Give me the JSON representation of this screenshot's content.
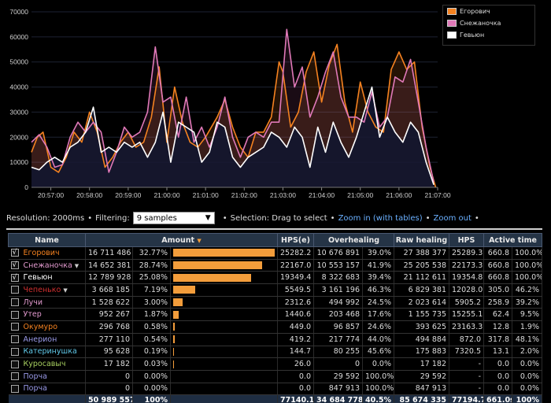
{
  "chart_data": {
    "type": "line",
    "y_ticks": [
      "0",
      "10000",
      "20000",
      "30000",
      "40000",
      "50000",
      "60000",
      "70000"
    ],
    "ylim": [
      0,
      70000
    ],
    "x_ticks": [
      "20:57:00",
      "20:58:00",
      "20:59:00",
      "21:00:00",
      "21:01:00",
      "21:02:00",
      "21:03:00",
      "21:04:00",
      "21:05:00",
      "21:06:00",
      "21:07:00"
    ],
    "xlim": [
      0,
      10.5
    ],
    "grid": true,
    "legend_position": "top-right",
    "series": [
      {
        "name": "Егорович",
        "color": "#f58220",
        "fill": "#f58220",
        "values": [
          [
            0,
            14000
          ],
          [
            0.15,
            20000
          ],
          [
            0.3,
            22000
          ],
          [
            0.5,
            8000
          ],
          [
            0.7,
            6000
          ],
          [
            0.9,
            12000
          ],
          [
            1.1,
            22000
          ],
          [
            1.3,
            18000
          ],
          [
            1.5,
            30000
          ],
          [
            1.7,
            22000
          ],
          [
            1.9,
            8000
          ],
          [
            2.1,
            12000
          ],
          [
            2.3,
            18000
          ],
          [
            2.5,
            22000
          ],
          [
            2.7,
            16000
          ],
          [
            2.9,
            18000
          ],
          [
            3.1,
            28000
          ],
          [
            3.3,
            48000
          ],
          [
            3.5,
            18000
          ],
          [
            3.7,
            40000
          ],
          [
            3.9,
            26000
          ],
          [
            4.1,
            18000
          ],
          [
            4.3,
            16000
          ],
          [
            4.5,
            20000
          ],
          [
            4.8,
            28000
          ],
          [
            5.0,
            35000
          ],
          [
            5.2,
            24000
          ],
          [
            5.4,
            16000
          ],
          [
            5.6,
            12000
          ],
          [
            5.8,
            22000
          ],
          [
            6.0,
            22000
          ],
          [
            6.2,
            28000
          ],
          [
            6.4,
            50000
          ],
          [
            6.5,
            46000
          ],
          [
            6.7,
            24000
          ],
          [
            6.9,
            30000
          ],
          [
            7.1,
            46000
          ],
          [
            7.3,
            54000
          ],
          [
            7.5,
            34000
          ],
          [
            7.7,
            49000
          ],
          [
            7.9,
            57000
          ],
          [
            8.1,
            34000
          ],
          [
            8.3,
            22000
          ],
          [
            8.5,
            42000
          ],
          [
            8.7,
            30000
          ],
          [
            8.9,
            24000
          ],
          [
            9.1,
            22000
          ],
          [
            9.3,
            47000
          ],
          [
            9.5,
            54000
          ],
          [
            9.7,
            47000
          ],
          [
            9.9,
            50000
          ],
          [
            10.1,
            24000
          ],
          [
            10.3,
            8000
          ],
          [
            10.45,
            0
          ]
        ]
      },
      {
        "name": "Снежаночка",
        "color": "#e079b8",
        "fill": "#b04e8a",
        "values": [
          [
            0,
            18000
          ],
          [
            0.2,
            21000
          ],
          [
            0.4,
            16000
          ],
          [
            0.6,
            8000
          ],
          [
            0.8,
            9000
          ],
          [
            1.0,
            20000
          ],
          [
            1.2,
            26000
          ],
          [
            1.4,
            22000
          ],
          [
            1.6,
            26000
          ],
          [
            1.8,
            22000
          ],
          [
            2.0,
            6000
          ],
          [
            2.2,
            14000
          ],
          [
            2.4,
            24000
          ],
          [
            2.6,
            20000
          ],
          [
            2.8,
            22000
          ],
          [
            3.0,
            30000
          ],
          [
            3.2,
            56000
          ],
          [
            3.4,
            34000
          ],
          [
            3.6,
            36000
          ],
          [
            3.8,
            20000
          ],
          [
            4.0,
            36000
          ],
          [
            4.2,
            18000
          ],
          [
            4.4,
            24000
          ],
          [
            4.6,
            16000
          ],
          [
            4.8,
            24000
          ],
          [
            5.0,
            36000
          ],
          [
            5.2,
            20000
          ],
          [
            5.4,
            12000
          ],
          [
            5.6,
            20000
          ],
          [
            5.8,
            22000
          ],
          [
            6.0,
            20000
          ],
          [
            6.2,
            26000
          ],
          [
            6.4,
            26000
          ],
          [
            6.6,
            63000
          ],
          [
            6.8,
            40000
          ],
          [
            7.0,
            48000
          ],
          [
            7.2,
            28000
          ],
          [
            7.4,
            36000
          ],
          [
            7.6,
            46000
          ],
          [
            7.8,
            54000
          ],
          [
            8.0,
            36000
          ],
          [
            8.2,
            28000
          ],
          [
            8.4,
            28000
          ],
          [
            8.6,
            26000
          ],
          [
            8.8,
            38000
          ],
          [
            9.0,
            24000
          ],
          [
            9.2,
            28000
          ],
          [
            9.4,
            44000
          ],
          [
            9.6,
            42000
          ],
          [
            9.8,
            51000
          ],
          [
            10.0,
            34000
          ],
          [
            10.2,
            16000
          ],
          [
            10.4,
            2000
          ]
        ]
      },
      {
        "name": "Гевьюн",
        "color": "#ffffff",
        "fill": "#0f1530",
        "values": [
          [
            0,
            8000
          ],
          [
            0.2,
            7000
          ],
          [
            0.4,
            10000
          ],
          [
            0.6,
            12000
          ],
          [
            0.8,
            10000
          ],
          [
            1.0,
            16000
          ],
          [
            1.2,
            18000
          ],
          [
            1.4,
            22000
          ],
          [
            1.6,
            32000
          ],
          [
            1.8,
            14000
          ],
          [
            2.0,
            16000
          ],
          [
            2.2,
            14000
          ],
          [
            2.4,
            18000
          ],
          [
            2.6,
            16000
          ],
          [
            2.8,
            18000
          ],
          [
            3.0,
            12000
          ],
          [
            3.2,
            18000
          ],
          [
            3.4,
            30000
          ],
          [
            3.6,
            10000
          ],
          [
            3.8,
            26000
          ],
          [
            4.0,
            24000
          ],
          [
            4.2,
            22000
          ],
          [
            4.4,
            10000
          ],
          [
            4.6,
            14000
          ],
          [
            4.8,
            26000
          ],
          [
            5.0,
            24000
          ],
          [
            5.2,
            12000
          ],
          [
            5.4,
            8000
          ],
          [
            5.6,
            12000
          ],
          [
            5.8,
            14000
          ],
          [
            6.0,
            16000
          ],
          [
            6.2,
            22000
          ],
          [
            6.4,
            20000
          ],
          [
            6.6,
            16000
          ],
          [
            6.8,
            24000
          ],
          [
            7.0,
            20000
          ],
          [
            7.2,
            8000
          ],
          [
            7.4,
            24000
          ],
          [
            7.6,
            14000
          ],
          [
            7.8,
            26000
          ],
          [
            8.0,
            18000
          ],
          [
            8.2,
            12000
          ],
          [
            8.4,
            20000
          ],
          [
            8.6,
            30000
          ],
          [
            8.8,
            40000
          ],
          [
            9.0,
            20000
          ],
          [
            9.2,
            28000
          ],
          [
            9.4,
            22000
          ],
          [
            9.6,
            18000
          ],
          [
            9.8,
            26000
          ],
          [
            10.0,
            22000
          ],
          [
            10.2,
            10000
          ],
          [
            10.4,
            1000
          ]
        ]
      }
    ]
  },
  "controls": {
    "resolution": "Resolution: 2000ms",
    "filtering_label": "Filtering:",
    "filtering_value": "9 samples",
    "selection": "Selection: Drag to select",
    "zoom_in": "Zoom in (with tables)",
    "zoom_out": "Zoom out",
    "bullet": "•"
  },
  "table": {
    "headers": {
      "name": "Name",
      "amount": "Amount",
      "hpse": "HPS(e)",
      "overhealing": "Overhealing",
      "raw": "Raw healing",
      "hps": "HPS",
      "active": "Active time"
    },
    "rows": [
      {
        "checked": true,
        "name": "Егорович",
        "color": "#f58220",
        "dropdown": false,
        "amount": "16 711 486",
        "pct": "32.77%",
        "bar": 1.0,
        "hpse": "25282.2",
        "over": "10 676 891",
        "overpct": "39.0%",
        "raw": "27 388 377",
        "hps": "25289.3",
        "time": "660.8",
        "timepct": "100.0%"
      },
      {
        "checked": true,
        "name": "Снежаночка",
        "color": "#e49bd0",
        "dropdown": true,
        "amount": "14 652 381",
        "pct": "28.74%",
        "bar": 0.877,
        "hpse": "22167.0",
        "over": "10 553 157",
        "overpct": "41.9%",
        "raw": "25 205 538",
        "hps": "22173.3",
        "time": "660.8",
        "timepct": "100.0%"
      },
      {
        "checked": true,
        "name": "Гевьюн",
        "color": "#ffffff",
        "dropdown": false,
        "amount": "12 789 928",
        "pct": "25.08%",
        "bar": 0.765,
        "hpse": "19349.4",
        "over": "8 322 683",
        "overpct": "39.4%",
        "raw": "21 112 611",
        "hps": "19354.8",
        "time": "660.8",
        "timepct": "100.0%"
      },
      {
        "checked": false,
        "name": "Чепенько",
        "color": "#d03030",
        "dropdown": true,
        "amount": "3 668 185",
        "pct": "7.19%",
        "bar": 0.219,
        "hpse": "5549.5",
        "over": "3 161 196",
        "overpct": "46.3%",
        "raw": "6 829 381",
        "hps": "12028.0",
        "time": "305.0",
        "timepct": "46.2%"
      },
      {
        "checked": false,
        "name": "Лучи",
        "color": "#e49bd0",
        "dropdown": false,
        "amount": "1 528 622",
        "pct": "3.00%",
        "bar": 0.091,
        "hpse": "2312.6",
        "over": "494 992",
        "overpct": "24.5%",
        "raw": "2 023 614",
        "hps": "5905.2",
        "time": "258.9",
        "timepct": "39.2%"
      },
      {
        "checked": false,
        "name": "Утер",
        "color": "#e49bd0",
        "dropdown": false,
        "amount": "952 267",
        "pct": "1.87%",
        "bar": 0.057,
        "hpse": "1440.6",
        "over": "203 468",
        "overpct": "17.6%",
        "raw": "1 155 735",
        "hps": "15255.1",
        "time": "62.4",
        "timepct": "9.5%"
      },
      {
        "checked": false,
        "name": "Окумуро",
        "color": "#f58220",
        "dropdown": false,
        "amount": "296 768",
        "pct": "0.58%",
        "bar": 0.018,
        "hpse": "449.0",
        "over": "96 857",
        "overpct": "24.6%",
        "raw": "393 625",
        "hps": "23163.3",
        "time": "12.8",
        "timepct": "1.9%"
      },
      {
        "checked": false,
        "name": "Анерион",
        "color": "#9a9ae8",
        "dropdown": false,
        "amount": "277 110",
        "pct": "0.54%",
        "bar": 0.017,
        "hpse": "419.2",
        "over": "217 774",
        "overpct": "44.0%",
        "raw": "494 884",
        "hps": "872.0",
        "time": "317.8",
        "timepct": "48.1%"
      },
      {
        "checked": false,
        "name": "Катеринушка",
        "color": "#60c8e8",
        "dropdown": false,
        "amount": "95 628",
        "pct": "0.19%",
        "bar": 0.006,
        "hpse": "144.7",
        "over": "80 255",
        "overpct": "45.6%",
        "raw": "175 883",
        "hps": "7320.5",
        "time": "13.1",
        "timepct": "2.0%"
      },
      {
        "checked": false,
        "name": "Куросавыч",
        "color": "#a8d060",
        "dropdown": false,
        "amount": "17 182",
        "pct": "0.03%",
        "bar": 0.001,
        "hpse": "26.0",
        "over": "0",
        "overpct": "0.0%",
        "raw": "17 182",
        "hps": "-",
        "time": "0.0",
        "timepct": "0.0%"
      },
      {
        "checked": false,
        "name": "Порча",
        "color": "#9a9ae8",
        "dropdown": false,
        "amount": "0",
        "pct": "0.00%",
        "bar": 0,
        "hpse": "0.0",
        "over": "29 592",
        "overpct": "100.0%",
        "raw": "29 592",
        "hps": "-",
        "time": "0.0",
        "timepct": "0.0%"
      },
      {
        "checked": false,
        "name": "Порча",
        "color": "#9a9ae8",
        "dropdown": false,
        "amount": "0",
        "pct": "0.00%",
        "bar": 0,
        "hpse": "0.0",
        "over": "847 913",
        "overpct": "100.0%",
        "raw": "847 913",
        "hps": "-",
        "time": "0.0",
        "timepct": "0.0%"
      }
    ],
    "footer": {
      "amount": "50 989 557",
      "pct": "100%",
      "hpse": "77140.1",
      "over": "34 684 778",
      "overpct": "40.5%",
      "raw": "85 674 335",
      "hps": "77194.7",
      "time": "661.0s",
      "timepct": "100%"
    }
  },
  "icons": {
    "checkbox_checked": "checkmark-icon",
    "dropdown": "caret-down-icon",
    "sort": "sort-desc-icon"
  },
  "glyphs": {
    "check": "√",
    "caret": "▼",
    "sort": "▼"
  }
}
